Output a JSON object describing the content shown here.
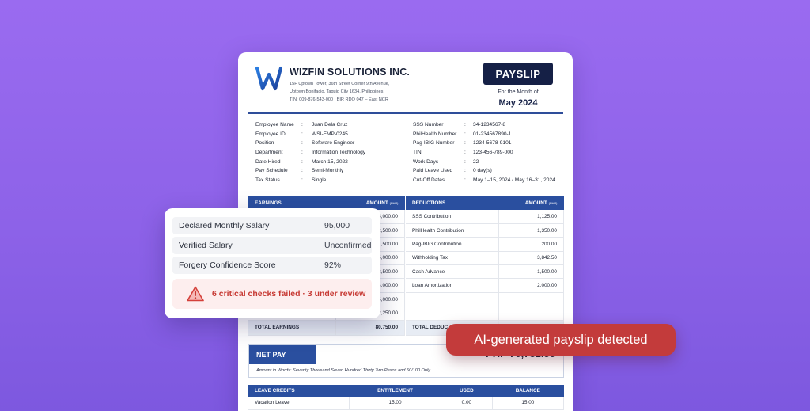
{
  "company": {
    "name": "WIZFIN SOLUTIONS INC.",
    "address_line1": "15F Uptown Tower, 36th Street Corner 9th Avenue,",
    "address_line2": "Uptown Bonifacio, Taguig City 1634, Philippines",
    "tin_line": "TIN: 009-876-543-000  |  BIR RDO 047 – East NCR"
  },
  "badge": "PAYSLIP",
  "period": {
    "label": "For the Month of",
    "month": "May 2024"
  },
  "info_left": [
    {
      "label": "Employee Name",
      "value": "Juan Dela Cruz"
    },
    {
      "label": "Employee ID",
      "value": "WSI-EMP-0245"
    },
    {
      "label": "Position",
      "value": "Software Engineer"
    },
    {
      "label": "Department",
      "value": "Information Technology"
    },
    {
      "label": "Date Hired",
      "value": "March 15, 2022"
    },
    {
      "label": "Pay Schedule",
      "value": "Semi-Monthly"
    },
    {
      "label": "Tax Status",
      "value": "Single"
    }
  ],
  "info_right": [
    {
      "label": "SSS Number",
      "value": "34-1234567-8"
    },
    {
      "label": "PhilHealth Number",
      "value": "01-234567890-1"
    },
    {
      "label": "Pag-IBIG Number",
      "value": "1234-5678-9101"
    },
    {
      "label": "TIN",
      "value": "123-456-789-000"
    },
    {
      "label": "Work Days",
      "value": "22"
    },
    {
      "label": "Paid Leave Used",
      "value": "0 day(s)"
    },
    {
      "label": "Cut-Off Dates",
      "value": "May 1–15, 2024 / May 16–31, 2024"
    }
  ],
  "earnings": {
    "header": "EARNINGS",
    "amount_header": "AMOUNT",
    "currency": "(PHP)",
    "rows": [
      "5,000.00",
      "2,500.00",
      "1,500.00",
      "5,000.00",
      "2,500.00",
      "3,000.00",
      "5,000.00",
      "2,250.00"
    ],
    "total_label": "TOTAL EARNINGS",
    "total": "80,750.00"
  },
  "deductions": {
    "header": "DEDUCTIONS",
    "amount_header": "AMOUNT",
    "currency": "(PHP)",
    "rows": [
      {
        "label": "SSS Contribution",
        "amount": "1,125.00"
      },
      {
        "label": "PhilHealth Contribution",
        "amount": "1,350.00"
      },
      {
        "label": "Pag-IBIG Contribution",
        "amount": "200.00"
      },
      {
        "label": "Withholding Tax",
        "amount": "3,842.50"
      },
      {
        "label": "Cash Advance",
        "amount": "1,500.00"
      },
      {
        "label": "Loan Amortization",
        "amount": "2,000.00"
      },
      {
        "label": "",
        "amount": ""
      },
      {
        "label": "",
        "amount": ""
      }
    ],
    "total_label": "TOTAL DEDUC"
  },
  "net_pay": {
    "label": "NET PAY",
    "amount": "PHP 70,782.50",
    "words_prefix": "Amount in Words:",
    "words": "Seventy Thousand Seven Hundred Thirty Two Pesos and 50/100 Only"
  },
  "leave": {
    "headers": [
      "LEAVE CREDITS",
      "ENTITLEMENT",
      "USED",
      "BALANCE"
    ],
    "rows": [
      [
        "Vacation Leave",
        "15.00",
        "0.00",
        "15.00"
      ]
    ]
  },
  "verification_card": {
    "rows": [
      {
        "label": "Declared Monthly Salary",
        "value": "95,000"
      },
      {
        "label": "Verified Salary",
        "value": "Unconfirmed"
      },
      {
        "label": "Forgery Confidence Score",
        "value": "92%"
      }
    ],
    "alert": "6 critical checks failed · 3 under review"
  },
  "detection_badge": "AI-generated payslip detected",
  "colors": {
    "background": "#9a6bf0",
    "navy": "#152046",
    "table_header": "#2a4f9f",
    "alert_red": "#c73a34",
    "badge_red": "#c33b3b"
  }
}
